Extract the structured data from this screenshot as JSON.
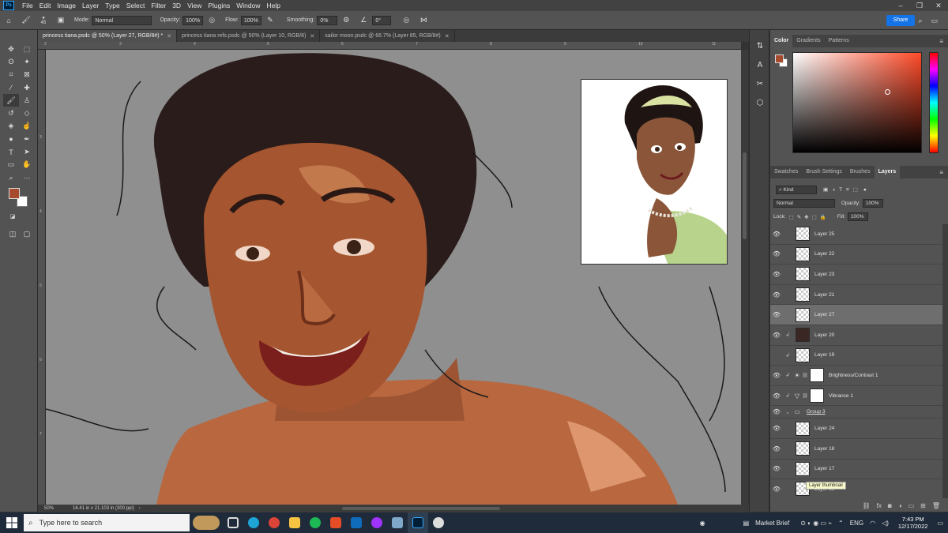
{
  "menu": {
    "logo": "Ps",
    "items": [
      "File",
      "Edit",
      "Image",
      "Layer",
      "Type",
      "Select",
      "Filter",
      "3D",
      "View",
      "Plugins",
      "Window",
      "Help"
    ],
    "window_controls": [
      "–",
      "❐",
      "✕"
    ]
  },
  "options": {
    "brush_size": "45",
    "mode_label": "Mode:",
    "mode_value": "Normal",
    "opacity_label": "Opacity:",
    "opacity_value": "100%",
    "flow_label": "Flow:",
    "flow_value": "100%",
    "smoothing_label": "Smoothing:",
    "smoothing_value": "0%",
    "angle_value": "0°",
    "share_label": "Share"
  },
  "tabs": [
    {
      "label": "princess tiana.psdc @ 50% (Layer 27, RGB/8#) *",
      "active": true
    },
    {
      "label": "princess tiana refs.psdc @ 50% (Layer 10, RGB/8)",
      "active": false
    },
    {
      "label": "sailor moon.psdc @ 66.7% (Layer 85, RGB/8#)",
      "active": false
    }
  ],
  "rulers": {
    "top": [
      "2",
      "3",
      "4",
      "5",
      "6",
      "7",
      "8",
      "9",
      "10",
      "11"
    ],
    "left": [
      "3",
      "4",
      "5",
      "6",
      "7"
    ]
  },
  "status": {
    "zoom": "50%",
    "doc_info": "16.41 in x 21.103 in (300 ppi)"
  },
  "color_panel": {
    "tabs": [
      "Color",
      "Gradients",
      "Patterns"
    ],
    "foreground": "#a74b2f",
    "background": "#ffffff"
  },
  "layers_panel": {
    "tabs": [
      "Swatches",
      "Brush Settings",
      "Brushes",
      "Layers"
    ],
    "filter_kind": "Kind",
    "blend_mode": "Normal",
    "opacity_label": "Opacity:",
    "opacity_value": "100%",
    "lock_label": "Lock:",
    "fill_label": "Fill:",
    "fill_value": "100%",
    "tooltip": "Layer thumbnail",
    "layers": [
      {
        "name": "Layer 25",
        "visible": true,
        "clip": false,
        "type": "pixel"
      },
      {
        "name": "Layer 22",
        "visible": true,
        "clip": false,
        "type": "pixel"
      },
      {
        "name": "Layer 23",
        "visible": true,
        "clip": false,
        "type": "pixel"
      },
      {
        "name": "Layer 21",
        "visible": true,
        "clip": false,
        "type": "pixel"
      },
      {
        "name": "Layer 27",
        "visible": true,
        "clip": false,
        "type": "pixel",
        "selected": true
      },
      {
        "name": "Layer 20",
        "visible": true,
        "clip": true,
        "type": "solid",
        "color": "#3a2622"
      },
      {
        "name": "Layer 19",
        "visible": false,
        "clip": true,
        "type": "pixel"
      },
      {
        "name": "Brightness/Contrast 1",
        "visible": true,
        "clip": true,
        "type": "brightness"
      },
      {
        "name": "Vibrance 1",
        "visible": true,
        "clip": true,
        "type": "vibrance"
      },
      {
        "name": "Group 3",
        "visible": true,
        "clip": false,
        "type": "group"
      },
      {
        "name": "Layer 24",
        "visible": true,
        "clip": false,
        "type": "pixel"
      },
      {
        "name": "Layer 18",
        "visible": true,
        "clip": false,
        "type": "pixel"
      },
      {
        "name": "Layer 17",
        "visible": true,
        "clip": false,
        "type": "pixel"
      },
      {
        "name": "Layer 16",
        "visible": true,
        "clip": false,
        "type": "pixel"
      }
    ]
  },
  "taskbar": {
    "search_placeholder": "Type here to search",
    "news": "Market Brief",
    "lang": "ENG",
    "time": "7:43 PM",
    "date": "12/17/2022"
  }
}
